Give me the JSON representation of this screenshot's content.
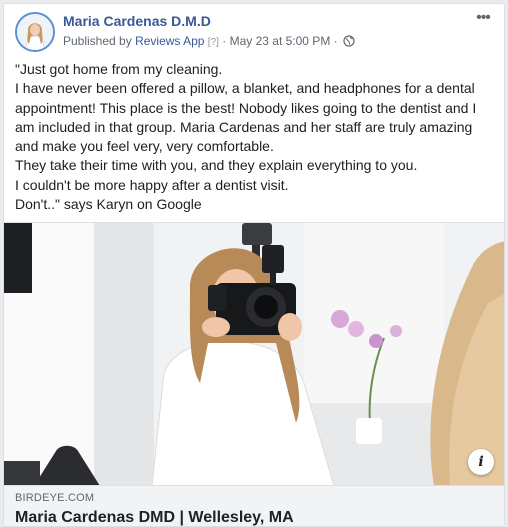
{
  "post": {
    "page_name": "Maria Cardenas D.M.D",
    "published_by_prefix": "Published by",
    "app_name": "Reviews App",
    "help_marker": "[?]",
    "separator": "·",
    "timestamp": "May 23 at 5:00 PM",
    "audience_icon": "globe-icon",
    "more_label": "•••",
    "text_lines": [
      "\"Just got home from my cleaning.",
      "I have never been offered a pillow, a blanket, and headphones for a dental",
      "appointment! This place is the best! Nobody likes going to the dentist and I",
      "am included in that group. Maria Cardenas and her staff are truly amazing",
      "and make you feel very, very comfortable.",
      "They take their time with you, and they explain everything to you.",
      "I couldn't be more happy after a dentist visit.",
      "Don't..\" says Karyn on Google"
    ]
  },
  "link_preview": {
    "info_label": "i",
    "domain": "BIRDEYE.COM",
    "title": "Maria Cardenas DMD | Wellesley, MA"
  },
  "colors": {
    "link_blue": "#385898",
    "meta_gray": "#606770",
    "footer_bg": "#f2f3f5"
  }
}
